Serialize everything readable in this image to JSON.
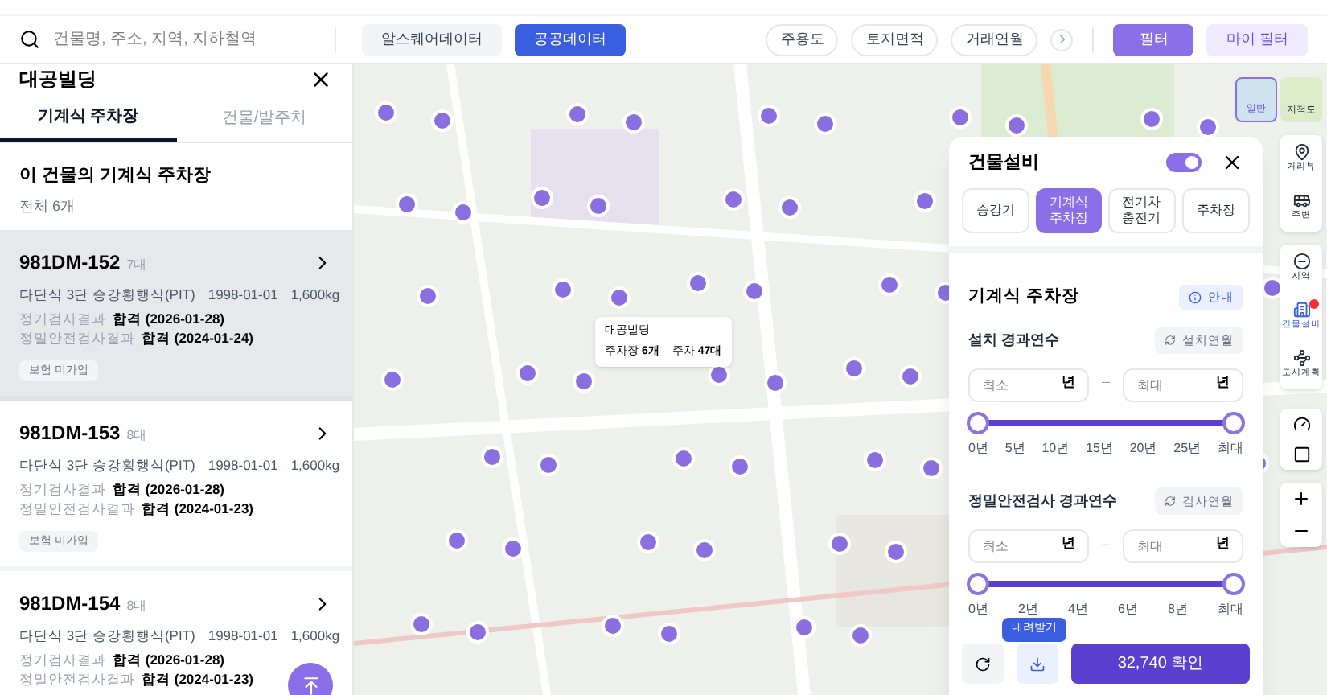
{
  "search": {
    "placeholder": "건물명, 주소, 지역, 지하철역"
  },
  "data_sources": [
    {
      "label": "알스퀘어데이터",
      "selected": false
    },
    {
      "label": "공공데이터",
      "selected": true
    }
  ],
  "quick_filters": [
    "주용도",
    "토지면적",
    "거래연월"
  ],
  "filter_button": "필터",
  "my_filter_button": "마이 필터",
  "side_panel": {
    "title": "대공빌딩",
    "tabs": [
      {
        "label": "기계식 주차장",
        "selected": true
      },
      {
        "label": "건물/발주처",
        "selected": false
      }
    ],
    "section_title": "이 건물의 기계식 주차장",
    "total": "전체 6개",
    "items": [
      {
        "id": "981DM-152",
        "count": "7대",
        "specs": [
          "다단식 3단 승강횡행식(PIT)",
          "1998-01-01",
          "1,600kg"
        ],
        "regular_label": "정기검사결과",
        "regular": "합격 (2026-01-28)",
        "precise_label": "정밀안전검사결과",
        "precise": "합격 (2024-01-24)",
        "tag": "보험 미가입",
        "selected": true
      },
      {
        "id": "981DM-153",
        "count": "8대",
        "specs": [
          "다단식 3단 승강횡행식(PIT)",
          "1998-01-01",
          "1,600kg"
        ],
        "regular_label": "정기검사결과",
        "regular": "합격 (2026-01-28)",
        "precise_label": "정밀안전검사결과",
        "precise": "합격 (2024-01-23)",
        "tag": "보험 미가입",
        "selected": false
      },
      {
        "id": "981DM-154",
        "count": "8대",
        "specs": [
          "다단식 3단 승강횡행식(PIT)",
          "1998-01-01",
          "1,600kg"
        ],
        "regular_label": "정기검사결과",
        "regular": "합격 (2026-01-28)",
        "precise_label": "정밀안전검사결과",
        "precise": "합격 (2024-01-23)",
        "selected": false
      }
    ]
  },
  "map_tooltip": {
    "title": "대공빌딩",
    "lines": [
      "주차장 **6개**",
      "주차 **47대**"
    ]
  },
  "equipment_panel": {
    "title": "건물설비",
    "on": true,
    "categories": [
      {
        "label": "승강기",
        "selected": false
      },
      {
        "label": "기계식\n주차장",
        "selected": true
      },
      {
        "label": "전기차\n충전기",
        "selected": false
      },
      {
        "label": "주차장",
        "selected": false
      }
    ],
    "section_title": "기계식 주차장",
    "info_button": "안내",
    "ranges": [
      {
        "label": "설치 경과연수",
        "reset": "설치연월",
        "min_placeholder": "최소",
        "min_unit": "년",
        "separator": "–",
        "max_placeholder": "최대",
        "max_unit": "년",
        "ticks": [
          "0년",
          "5년",
          "10년",
          "15년",
          "20년",
          "25년",
          "최대"
        ]
      },
      {
        "label": "정밀안전검사 경과연수",
        "reset": "검사연월",
        "min_placeholder": "최소",
        "min_unit": "년",
        "separator": "–",
        "max_placeholder": "최대",
        "max_unit": "년",
        "ticks": [
          "0년",
          "2년",
          "4년",
          "6년",
          "8년",
          "최대"
        ]
      }
    ],
    "download_tooltip": "내려받기",
    "confirm": "32,740 확인"
  },
  "map_types": [
    {
      "label": "일반",
      "selected": true
    },
    {
      "label": "지적도",
      "selected": false
    }
  ],
  "tools": [
    [
      {
        "label": "거리뷰",
        "selected": false
      },
      {
        "label": "주변",
        "selected": false
      }
    ],
    [
      {
        "label": "지역",
        "selected": false
      },
      {
        "label": "건물설비",
        "selected": true,
        "badge": true
      },
      {
        "label": "도시계획",
        "selected": false
      }
    ]
  ]
}
